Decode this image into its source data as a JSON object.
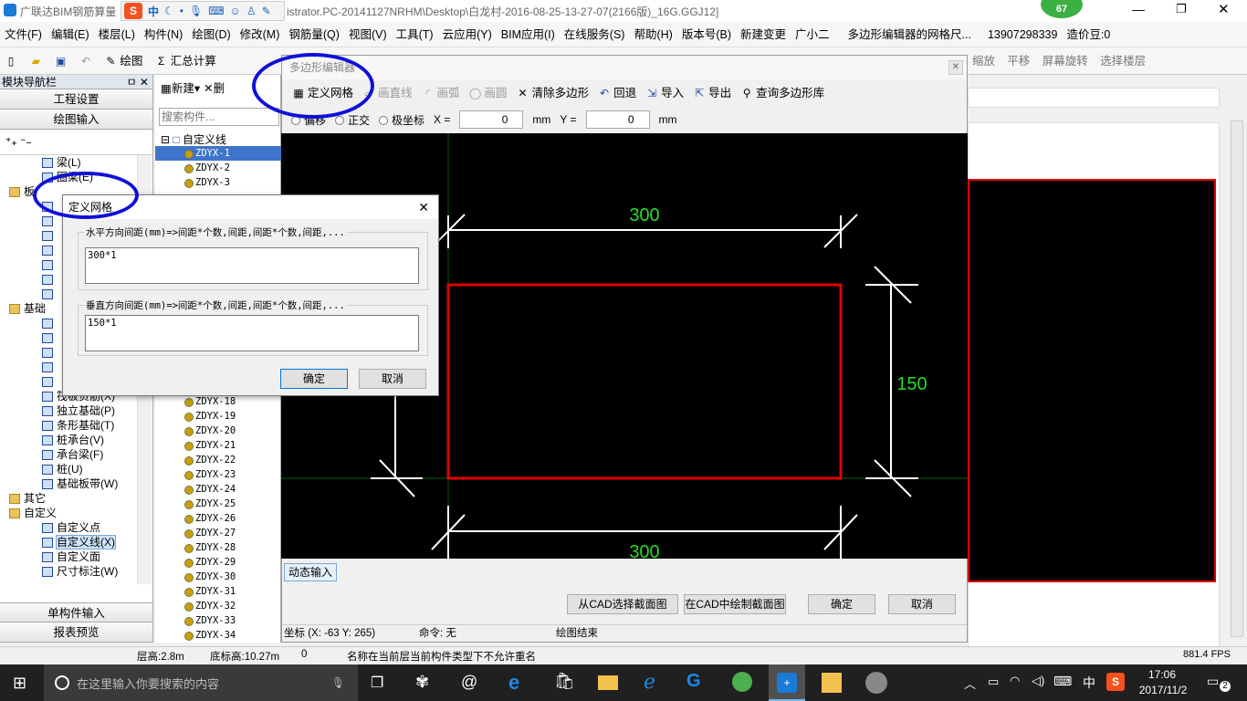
{
  "window": {
    "title_prefix": "广联达BIM钢筋算量",
    "title_path": "istrator.PC-20141127NRHM\\Desktop\\白龙村-2016-08-25-13-27-07(2166版)_16G.GGJ12]",
    "ime_labels": [
      "中"
    ],
    "badge": "67"
  },
  "menu": [
    "文件(F)",
    "编辑(E)",
    "楼层(L)",
    "构件(N)",
    "绘图(D)",
    "修改(M)",
    "钢筋量(Q)",
    "视图(V)",
    "工具(T)",
    "云应用(Y)",
    "BIM应用(I)",
    "在线服务(S)",
    "帮助(H)",
    "版本号(B)",
    "新建变更",
    "广小二",
    "多边形编辑器的网格尺...",
    "13907298339",
    "造价豆:0"
  ],
  "toolbar": {
    "draw": "绘图",
    "sum": "汇总计算",
    "right_items": [
      "缩放",
      "平移",
      "屏幕旋转",
      "选择楼层"
    ]
  },
  "left_panel": {
    "header": "模块导航栏",
    "btn_settings": "工程设置",
    "btn_draw_input": "绘图输入",
    "tree": [
      {
        "label": "梁(L)",
        "indent": 2
      },
      {
        "label": "圈梁(E)",
        "indent": 2
      },
      {
        "label": "板",
        "indent": 1,
        "folder": true
      },
      {
        "label": "",
        "indent": 2
      },
      {
        "label": "",
        "indent": 2
      },
      {
        "label": "",
        "indent": 2
      },
      {
        "label": "",
        "indent": 2
      },
      {
        "label": "",
        "indent": 2
      },
      {
        "label": "",
        "indent": 2
      },
      {
        "label": "",
        "indent": 2
      },
      {
        "label": "基础",
        "indent": 1,
        "folder": true
      },
      {
        "label": "",
        "indent": 2
      },
      {
        "label": "",
        "indent": 2
      },
      {
        "label": "",
        "indent": 2
      },
      {
        "label": "",
        "indent": 2
      },
      {
        "label": "",
        "indent": 2
      },
      {
        "label": "筏板负筋(X)",
        "indent": 2
      },
      {
        "label": "独立基础(P)",
        "indent": 2
      },
      {
        "label": "条形基础(T)",
        "indent": 2
      },
      {
        "label": "桩承台(V)",
        "indent": 2
      },
      {
        "label": "承台梁(F)",
        "indent": 2
      },
      {
        "label": "桩(U)",
        "indent": 2
      },
      {
        "label": "基础板带(W)",
        "indent": 2
      },
      {
        "label": "其它",
        "indent": 1,
        "folder": true
      },
      {
        "label": "自定义",
        "indent": 1,
        "folder": true
      },
      {
        "label": "自定义点",
        "indent": 2
      },
      {
        "label": "自定义线(X)",
        "indent": 2,
        "selected": true
      },
      {
        "label": "自定义面",
        "indent": 2
      },
      {
        "label": "尺寸标注(W)",
        "indent": 2
      }
    ],
    "btn_single": "单构件输入",
    "btn_report": "报表预览"
  },
  "mid_panel": {
    "new": "新建",
    "delete": "删",
    "search_placeholder": "搜索构件...",
    "root": "自定义线",
    "items_top": [
      "ZDYX-1",
      "ZDYX-2",
      "ZDYX-3"
    ],
    "items": [
      "ZDYX-18",
      "ZDYX-19",
      "ZDYX-20",
      "ZDYX-21",
      "ZDYX-22",
      "ZDYX-23",
      "ZDYX-24",
      "ZDYX-25",
      "ZDYX-26",
      "ZDYX-27",
      "ZDYX-28",
      "ZDYX-29",
      "ZDYX-30",
      "ZDYX-31",
      "ZDYX-32",
      "ZDYX-33",
      "ZDYX-34"
    ]
  },
  "editor": {
    "title": "多边形编辑器",
    "tools": [
      "定义网格",
      "画直线",
      "画弧",
      "画圆",
      "清除多边形",
      "回退",
      "导入",
      "导出",
      "查询多边形库"
    ],
    "mode_options": [
      "偏移",
      "正交",
      "极坐标"
    ],
    "x_label": "X =",
    "x_value": "0",
    "y_label": "Y =",
    "y_value": "0",
    "unit": "mm",
    "dim_top": "300",
    "dim_right": "150",
    "dim_bottom": "300",
    "dynamic_input": "动态输入",
    "btn_cad_select": "从CAD选择截面图",
    "btn_cad_draw": "在CAD中绘制截面图",
    "btn_ok": "确定",
    "btn_cancel": "取消",
    "status_coord": "坐标 (X: -63 Y: 265)",
    "status_cmd": "命令: 无",
    "status_draw": "绘图结束"
  },
  "dialog": {
    "title": "定义网格",
    "h_label": "水平方向间距(mm)=>间距*个数,间距,间距*个数,间距,...",
    "h_value": "300*1",
    "v_label": "垂直方向间距(mm)=>间距*个数,间距,间距*个数,间距,...",
    "v_value": "150*1",
    "ok": "确定",
    "cancel": "取消"
  },
  "statusbar": {
    "floor_h": "层高:2.8m",
    "bottom_h": "底标高:10.27m",
    "zero": "0",
    "message": "名称在当前层当前构件类型下不允许重名",
    "fps": "881.4 FPS"
  },
  "taskbar": {
    "search_placeholder": "在这里输入你要搜索的内容",
    "ime": "中",
    "time": "17:06",
    "date": "2017/11/2",
    "notif": "2"
  },
  "colors": {
    "annotation": "#1010d8",
    "rect": "#e00000",
    "dim_text": "#22dd22"
  }
}
